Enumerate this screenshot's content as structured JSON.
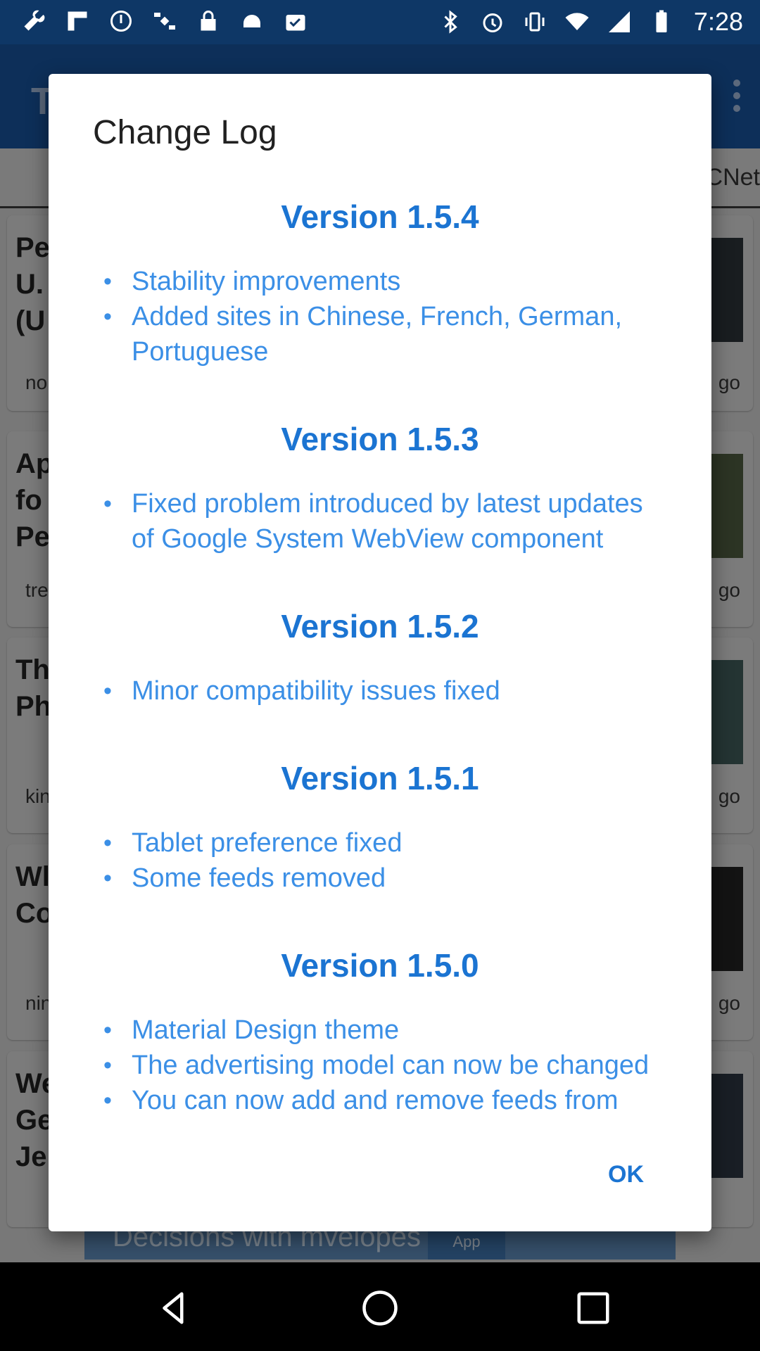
{
  "status_bar": {
    "time": "7:28",
    "icons_left": [
      "wrench-icon",
      "flipboard-icon",
      "clock-circle-icon",
      "satellite-icon",
      "lock-icon",
      "android-icon",
      "checklist-icon"
    ],
    "icons_right": [
      "bluetooth-icon",
      "alarm-icon",
      "vibrate-icon",
      "wifi-icon",
      "signal-icon",
      "battery-icon"
    ]
  },
  "background": {
    "app_title_fragment": "T",
    "tab_fragment": "CNet",
    "cards": [
      {
        "title": "Pe\nU.\n(U",
        "source": "no",
        "age": "go"
      },
      {
        "title": "Ap\nfo\nPe",
        "source": "tre",
        "age": "go"
      },
      {
        "title": "Th\nPh",
        "source": "kin",
        "age": "go"
      },
      {
        "title": "Wl\nCo",
        "source": "nin",
        "age": "go"
      },
      {
        "title": "We\nGe\nJe",
        "source": "",
        "age": ""
      }
    ],
    "ad": {
      "text": "Decisions with mvelopes",
      "button": "App"
    }
  },
  "dialog": {
    "title": "Change Log",
    "ok_label": "OK",
    "versions": [
      {
        "heading": "Version 1.5.4",
        "notes": [
          "Stability improvements",
          "Added sites in Chinese, French, German, Portuguese"
        ]
      },
      {
        "heading": "Version 1.5.3",
        "notes": [
          "Fixed problem introduced by latest updates of Google System WebView component"
        ]
      },
      {
        "heading": "Version 1.5.2",
        "notes": [
          "Minor compatibility issues fixed"
        ]
      },
      {
        "heading": "Version 1.5.1",
        "notes": [
          "Tablet preference fixed",
          "Some feeds removed"
        ]
      },
      {
        "heading": "Version 1.5.0",
        "notes": [
          "Material Design theme",
          "The advertising model can now be changed",
          "You can now add and remove feeds from"
        ]
      }
    ]
  },
  "nav": {
    "back": "back-icon",
    "home": "home-icon",
    "recents": "recents-icon"
  }
}
